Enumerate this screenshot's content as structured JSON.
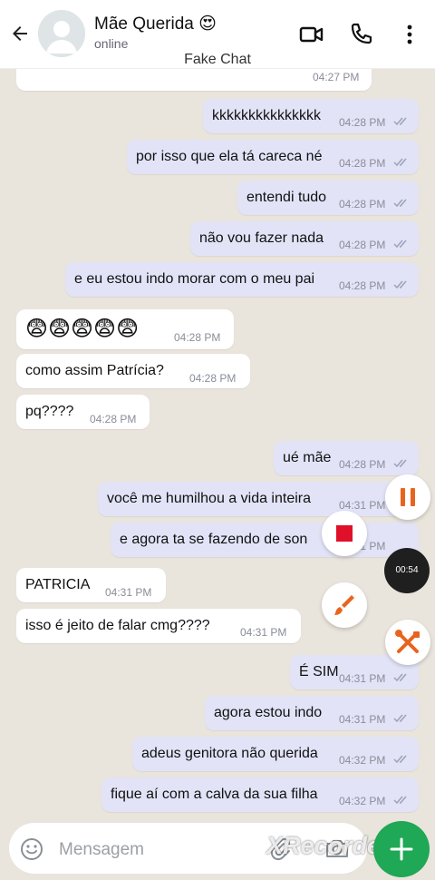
{
  "header": {
    "contact_name": "Mãe Querida 😍",
    "status": "online",
    "label": "Fake Chat"
  },
  "chat": {
    "top_partial_time": "04:27 PM",
    "messages": [
      {
        "dir": "out",
        "text": "kkkkkkkkkkkkkkk",
        "time": "04:28 PM"
      },
      {
        "dir": "out",
        "text": "por isso que ela tá careca né",
        "time": "04:28 PM"
      },
      {
        "dir": "out",
        "text": "entendi tudo",
        "time": "04:28 PM"
      },
      {
        "dir": "out",
        "text": "não vou fazer nada",
        "time": "04:28 PM"
      },
      {
        "dir": "out",
        "text": "e eu estou indo morar com o meu pai",
        "time": "04:28 PM"
      },
      {
        "dir": "in",
        "text": "😨😨😨😨😨",
        "time": "04:28 PM"
      },
      {
        "dir": "in",
        "text": "como assim Patrícia?",
        "time": "04:28 PM"
      },
      {
        "dir": "in",
        "text": "pq????",
        "time": "04:28 PM"
      },
      {
        "dir": "out",
        "text": "ué mãe",
        "time": "04:28 PM"
      },
      {
        "dir": "out",
        "text": "você me humilhou a vida inteira",
        "time": "04:31 PM"
      },
      {
        "dir": "out",
        "text": "e agora ta se fazendo de son",
        "time": "04:31 PM"
      },
      {
        "dir": "in",
        "text": "PATRICIA",
        "time": "04:31 PM"
      },
      {
        "dir": "in",
        "text": "isso é jeito de falar cmg????",
        "time": "04:31 PM"
      },
      {
        "dir": "out",
        "text": "É SIM",
        "time": "04:31 PM"
      },
      {
        "dir": "out",
        "text": "agora estou indo",
        "time": "04:31 PM"
      },
      {
        "dir": "out",
        "text": "adeus genitora não querida",
        "time": "04:32 PM"
      },
      {
        "dir": "out",
        "text": "fique aí com a calva da sua filha",
        "time": "04:32 PM"
      }
    ]
  },
  "recorder": {
    "timer": "00:54",
    "watermark": "XRecorder"
  },
  "composer": {
    "placeholder": "Mensagem"
  },
  "colors": {
    "outgoing_bubble": "#e2e3f7",
    "incoming_bubble": "#ffffff",
    "send_button": "#1fa855",
    "recorder_orange": "#e8641e",
    "recorder_red": "#e0102a",
    "ticks": "#9aa3b8"
  },
  "icons": [
    "back-arrow-icon",
    "video-call-icon",
    "phone-icon",
    "more-vert-icon",
    "pause-icon",
    "stop-icon",
    "brush-icon",
    "tools-icon",
    "emoji-icon",
    "camera-icon",
    "send-icon"
  ]
}
